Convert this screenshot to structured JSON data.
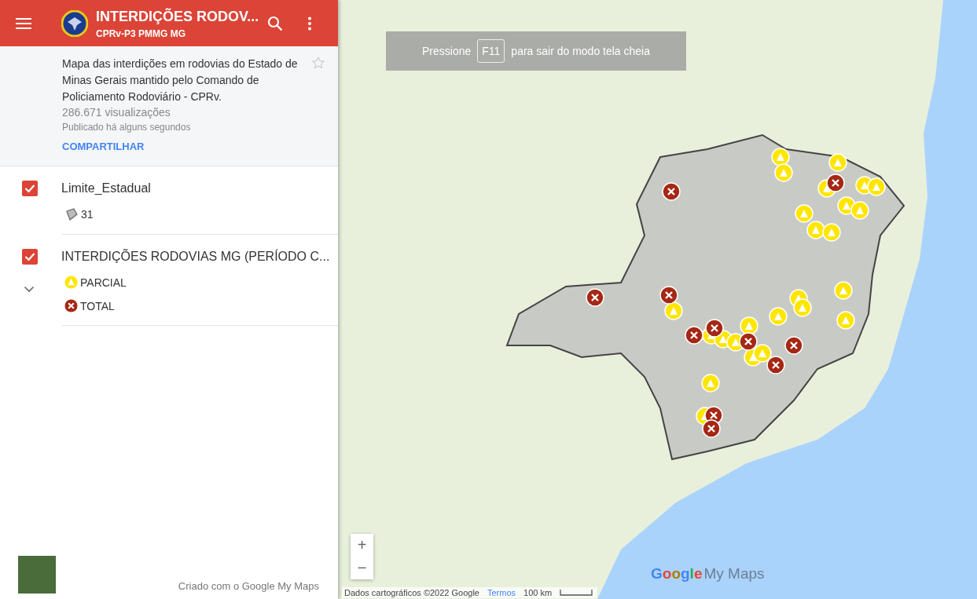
{
  "header": {
    "title": "INTERDIÇÕES RODOV...",
    "subtitle": "CPRv-P3 PMMG MG"
  },
  "info": {
    "description": "Mapa das interdições em rodovias do Estado de Minas Gerais mantido pelo Comando de Policiamento Rodoviário - CPRv.",
    "views": "286.671 visualizações",
    "published": "Publicado há alguns segundos",
    "share": "COMPARTILHAR",
    "starred": false
  },
  "layers": [
    {
      "name": "Limite_Estadual",
      "checked": true,
      "items": [
        {
          "kind": "polygon",
          "label": "31"
        }
      ]
    },
    {
      "name": "INTERDIÇÕES RODOVIAS MG (PERÍODO C...",
      "checked": true,
      "expanded": true,
      "items": [
        {
          "kind": "partial",
          "label": "PARCIAL"
        },
        {
          "kind": "total",
          "label": "TOTAL"
        }
      ]
    }
  ],
  "footer": "Criado com o Google My Maps",
  "map": {
    "fullscreen_notice": {
      "before": "Pressione",
      "key": "F11",
      "after": "para sair do modo tela cheia"
    },
    "zoom_in": "+",
    "zoom_out": "−",
    "attribution": "Dados cartográficos ©2022 Google",
    "terms": "Termos",
    "scale": "100 km",
    "logo": {
      "google": "Google",
      "product": "My Maps"
    }
  }
}
